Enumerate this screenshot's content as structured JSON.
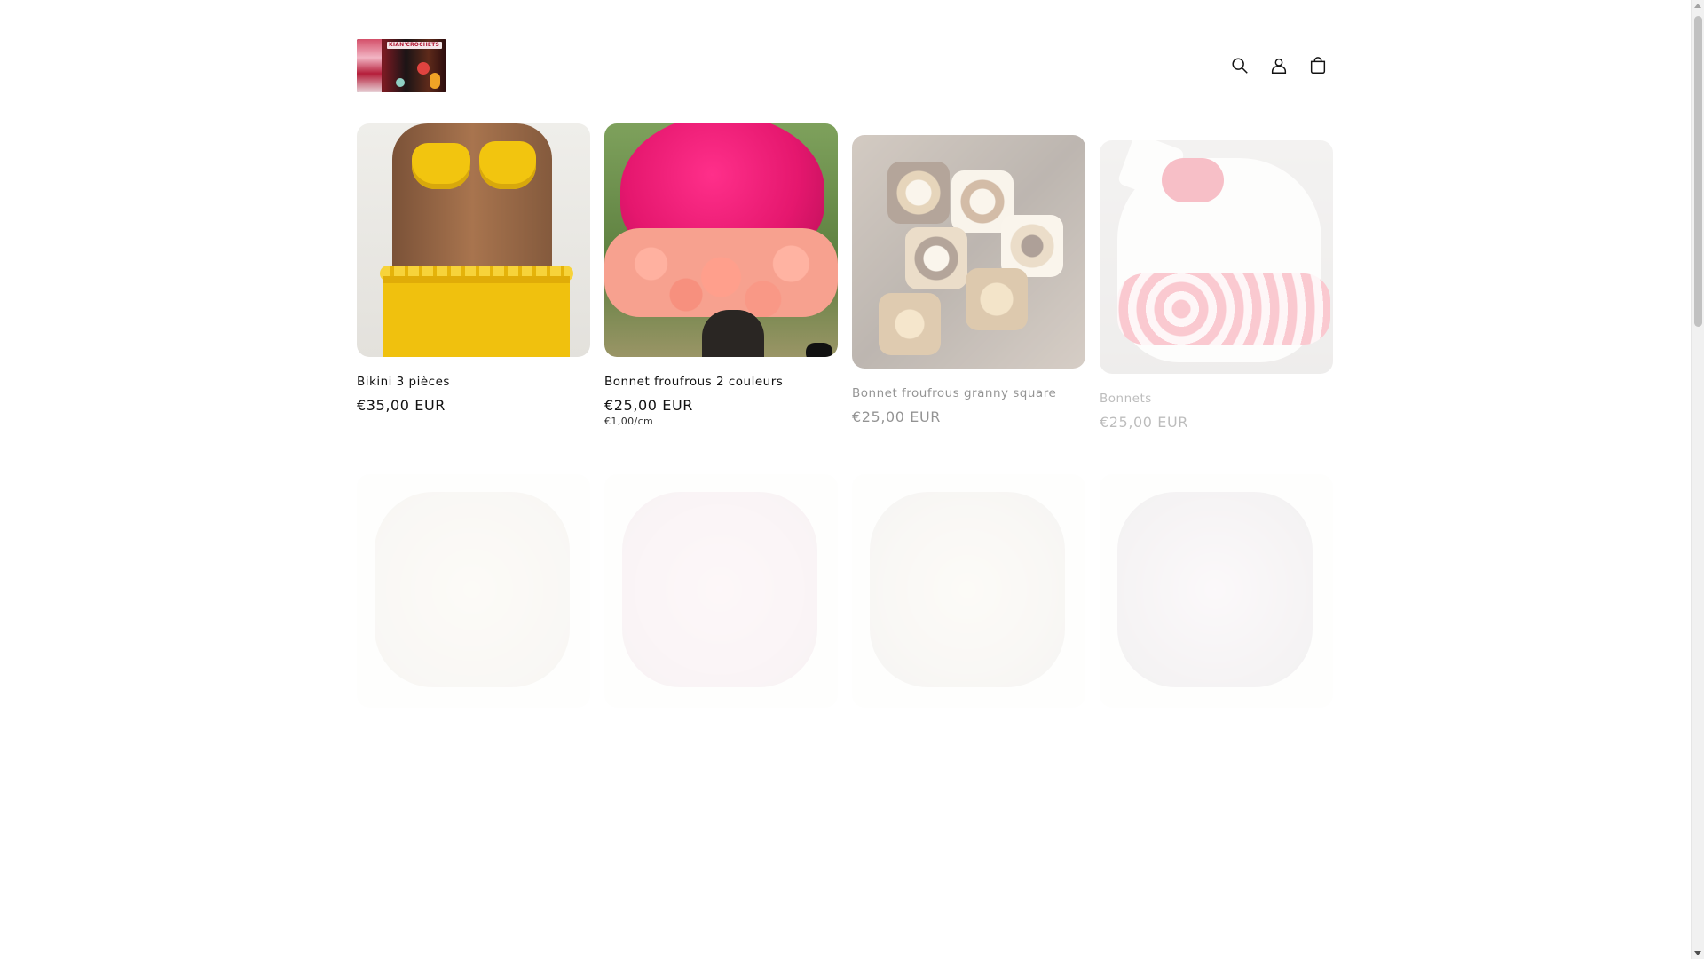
{
  "header": {
    "logo_text": "KIAN'CROCHETS",
    "icons": [
      "search-icon",
      "account-icon",
      "cart-icon"
    ]
  },
  "products": [
    {
      "title": "Bikini 3 pièces",
      "price": "€35,00 EUR",
      "unit_price": ""
    },
    {
      "title": "Bonnet froufrous 2 couleurs",
      "price": "€25,00 EUR",
      "unit_price": "€1,00/cm"
    },
    {
      "title": "Bonnet froufrous granny square",
      "price": "€25,00 EUR",
      "unit_price": ""
    },
    {
      "title": "Bonnets",
      "price": "€25,00 EUR",
      "unit_price": ""
    },
    {
      "title": "",
      "price": "",
      "unit_price": ""
    },
    {
      "title": "",
      "price": "",
      "unit_price": ""
    },
    {
      "title": "",
      "price": "",
      "unit_price": ""
    },
    {
      "title": "",
      "price": "",
      "unit_price": ""
    }
  ]
}
